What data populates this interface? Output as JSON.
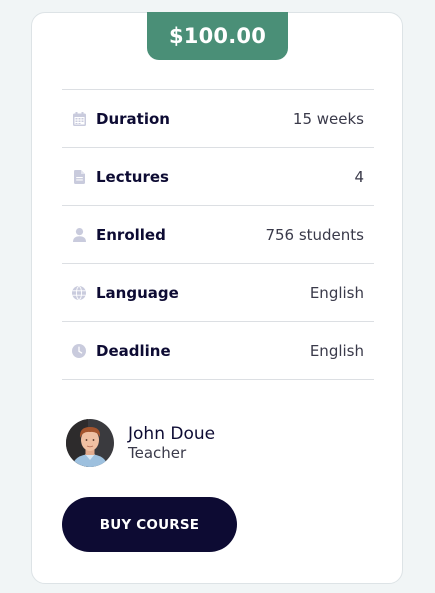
{
  "price": "$100.00",
  "details": {
    "duration": {
      "label": "Duration",
      "value": "15 weeks",
      "icon": "calendar-icon"
    },
    "lectures": {
      "label": "Lectures",
      "value": "4",
      "icon": "document-icon"
    },
    "enrolled": {
      "label": "Enrolled",
      "value": "756 students",
      "icon": "user-icon"
    },
    "language": {
      "label": "Language",
      "value": "English",
      "icon": "globe-icon"
    },
    "deadline": {
      "label": "Deadline",
      "value": "English",
      "icon": "clock-icon"
    }
  },
  "teacher": {
    "name": "John Doue",
    "role": "Teacher"
  },
  "buy_button": "BUY COURSE",
  "colors": {
    "accent": "#4a8f77",
    "dark": "#0d0b33",
    "icon": "#c9cbdd"
  }
}
